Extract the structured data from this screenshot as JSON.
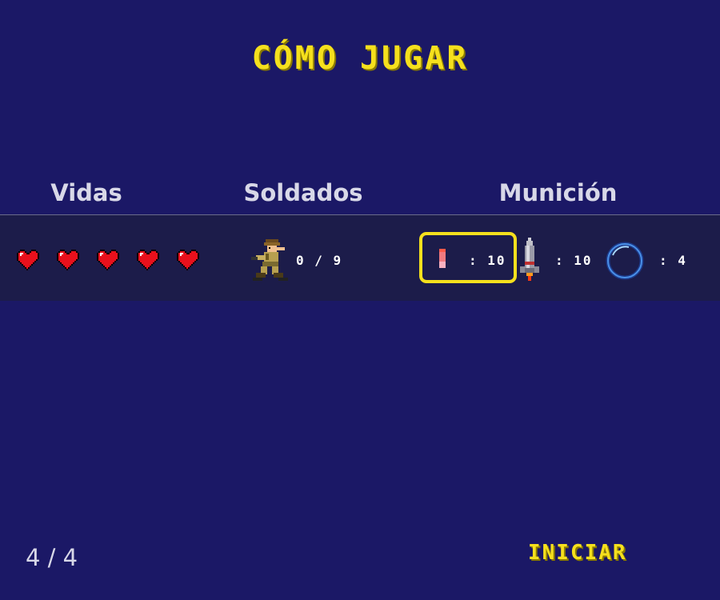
{
  "screen": {
    "title": "CÓMO JUGAR",
    "page_indicator": "4 / 4",
    "start_label": "INICIAR"
  },
  "headers": {
    "lives": "Vidas",
    "soldiers": "Soldados",
    "ammo": "Munición"
  },
  "hud": {
    "lives_count": 5,
    "lives_icon": "heart-icon",
    "soldier_icon": "soldier-icon",
    "soldiers_counter": "0 / 9",
    "bullet_icon": "bullet-icon",
    "bullet_counter": ": 10",
    "rocket_icon": "rocket-icon",
    "rocket_counter": ": 10",
    "shield_icon": "shield-bubble-icon",
    "shield_counter": ": 4",
    "highlighted_item": "bullet"
  },
  "colors": {
    "background": "#1b1866",
    "hud_bar": "#1c1c4a",
    "accent_yellow": "#f5e01d",
    "header_text": "#d8d8e8",
    "heart_red": "#e8101c"
  }
}
